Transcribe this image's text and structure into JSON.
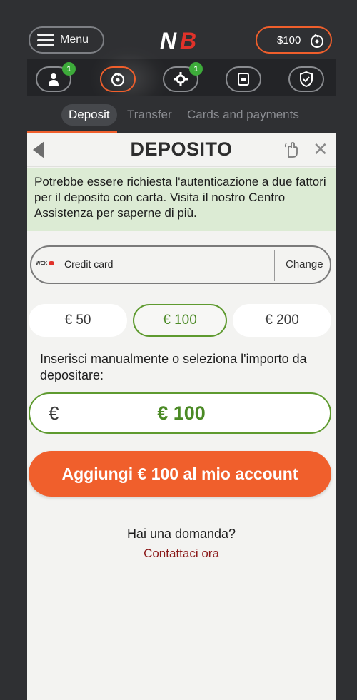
{
  "header": {
    "menu_label": "Menu",
    "logo_text": "NB",
    "balance": "$100"
  },
  "icon_nav": {
    "items": [
      {
        "icon": "user-icon",
        "badge": "1",
        "active": false
      },
      {
        "icon": "wallet-icon",
        "badge": "",
        "active": true
      },
      {
        "icon": "gear-icon",
        "badge": "1",
        "active": false
      },
      {
        "icon": "document-icon",
        "badge": "",
        "active": false
      },
      {
        "icon": "shield-icon",
        "badge": "",
        "active": false
      }
    ]
  },
  "tabs": [
    {
      "label": "Deposit",
      "active": true
    },
    {
      "label": "Transfer",
      "active": false
    },
    {
      "label": "Cards and payments",
      "active": false
    }
  ],
  "panel": {
    "title": "DEPOSITO",
    "notice": "Potrebbe essere richiesta l'autenticazione a due fattori per il deposito con carta. Visita il nostro Centro Assistenza per saperne di più.",
    "payment_method": {
      "logo_text": "WEK",
      "label": "Credit card",
      "change_label": "Change"
    },
    "amounts": [
      {
        "label": "€ 50",
        "selected": false
      },
      {
        "label": "€ 100",
        "selected": true
      },
      {
        "label": "€ 200",
        "selected": false
      }
    ],
    "instructions": "Inserisci manualmente o seleziona l'importo da depositare:",
    "input": {
      "currency_symbol": "€",
      "value": "€ 100"
    },
    "cta_label": "Aggiungi € 100 al mio account",
    "question": "Hai una domanda?",
    "contact_label": "Contattaci ora"
  },
  "colors": {
    "accent": "#f05f2c",
    "success": "#4b8a25",
    "badge": "#3dab3a",
    "background": "#2f3033",
    "panel": "#f3f3f1",
    "notice_bg": "#dcebd4"
  }
}
